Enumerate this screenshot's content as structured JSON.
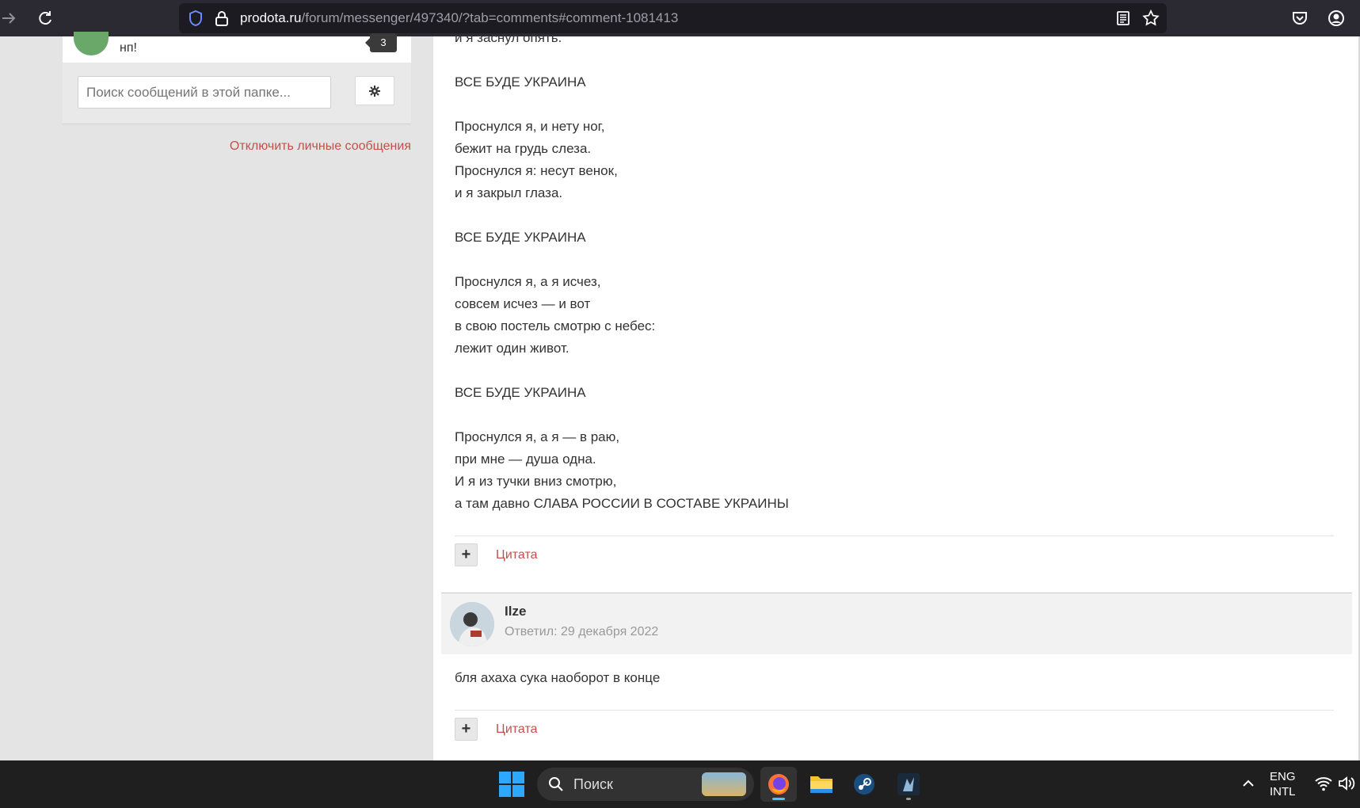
{
  "browser": {
    "url_host": "prodota.ru",
    "url_path": "/forum/messenger/497340/?tab=comments#comment-1081413"
  },
  "sidebar": {
    "conversation_preview": "нп!",
    "unread_badge": "3",
    "search_placeholder": "Поиск сообщений в этой папке...",
    "disable_pm_link": "Отключить личные сообщения"
  },
  "post": {
    "poem_lines": [
      "и я заснул опять.",
      "",
      "ВСЕ БУДЕ УКРАИНА",
      "",
      "Проснулся я, и нету ног,",
      "бежит на грудь слеза.",
      "Проснулся я: несут венок,",
      "и я закрыл глаза.",
      "",
      "ВСЕ БУДЕ УКРАИНА",
      "",
      "Проснулся я, а я исчез,",
      "совсем исчез — и вот",
      "в свою постель смотрю с небес:",
      "лежит один живот.",
      "",
      "ВСЕ БУДЕ УКРАИНА",
      "",
      "Проснулся я, а я — в раю,",
      "при мне — душа одна.",
      "И я из тучки вниз смотрю,",
      "а там давно СЛАВА РОССИИ В СОСТАВЕ УКРАИНЫ"
    ],
    "plus_label": "+",
    "quote_label": "Цитата"
  },
  "reply": {
    "author": "Ilze",
    "date": "Ответил: 29 декабря 2022",
    "body": "бля ахаха сука наоборот в конце",
    "plus_label": "+",
    "quote_label": "Цитата"
  },
  "taskbar": {
    "search_label": "Поиск",
    "lang_line1": "ENG",
    "lang_line2": "INTL"
  },
  "colors": {
    "link": "#c0524a",
    "toolbar_bg": "#2b2a33",
    "taskbar_bg": "#1f1f1f",
    "sidebar_bg": "#e4e4e4"
  },
  "icons": [
    "forward-icon",
    "reload-icon",
    "shield-icon",
    "lock-icon",
    "reader-view-icon",
    "bookmark-star-icon",
    "pocket-icon",
    "account-icon",
    "gear-icon",
    "windows-icon",
    "search-icon",
    "firefox-icon",
    "file-explorer-icon",
    "steam-icon",
    "game-app-icon",
    "chevron-up-icon",
    "wifi-icon",
    "volume-icon"
  ]
}
